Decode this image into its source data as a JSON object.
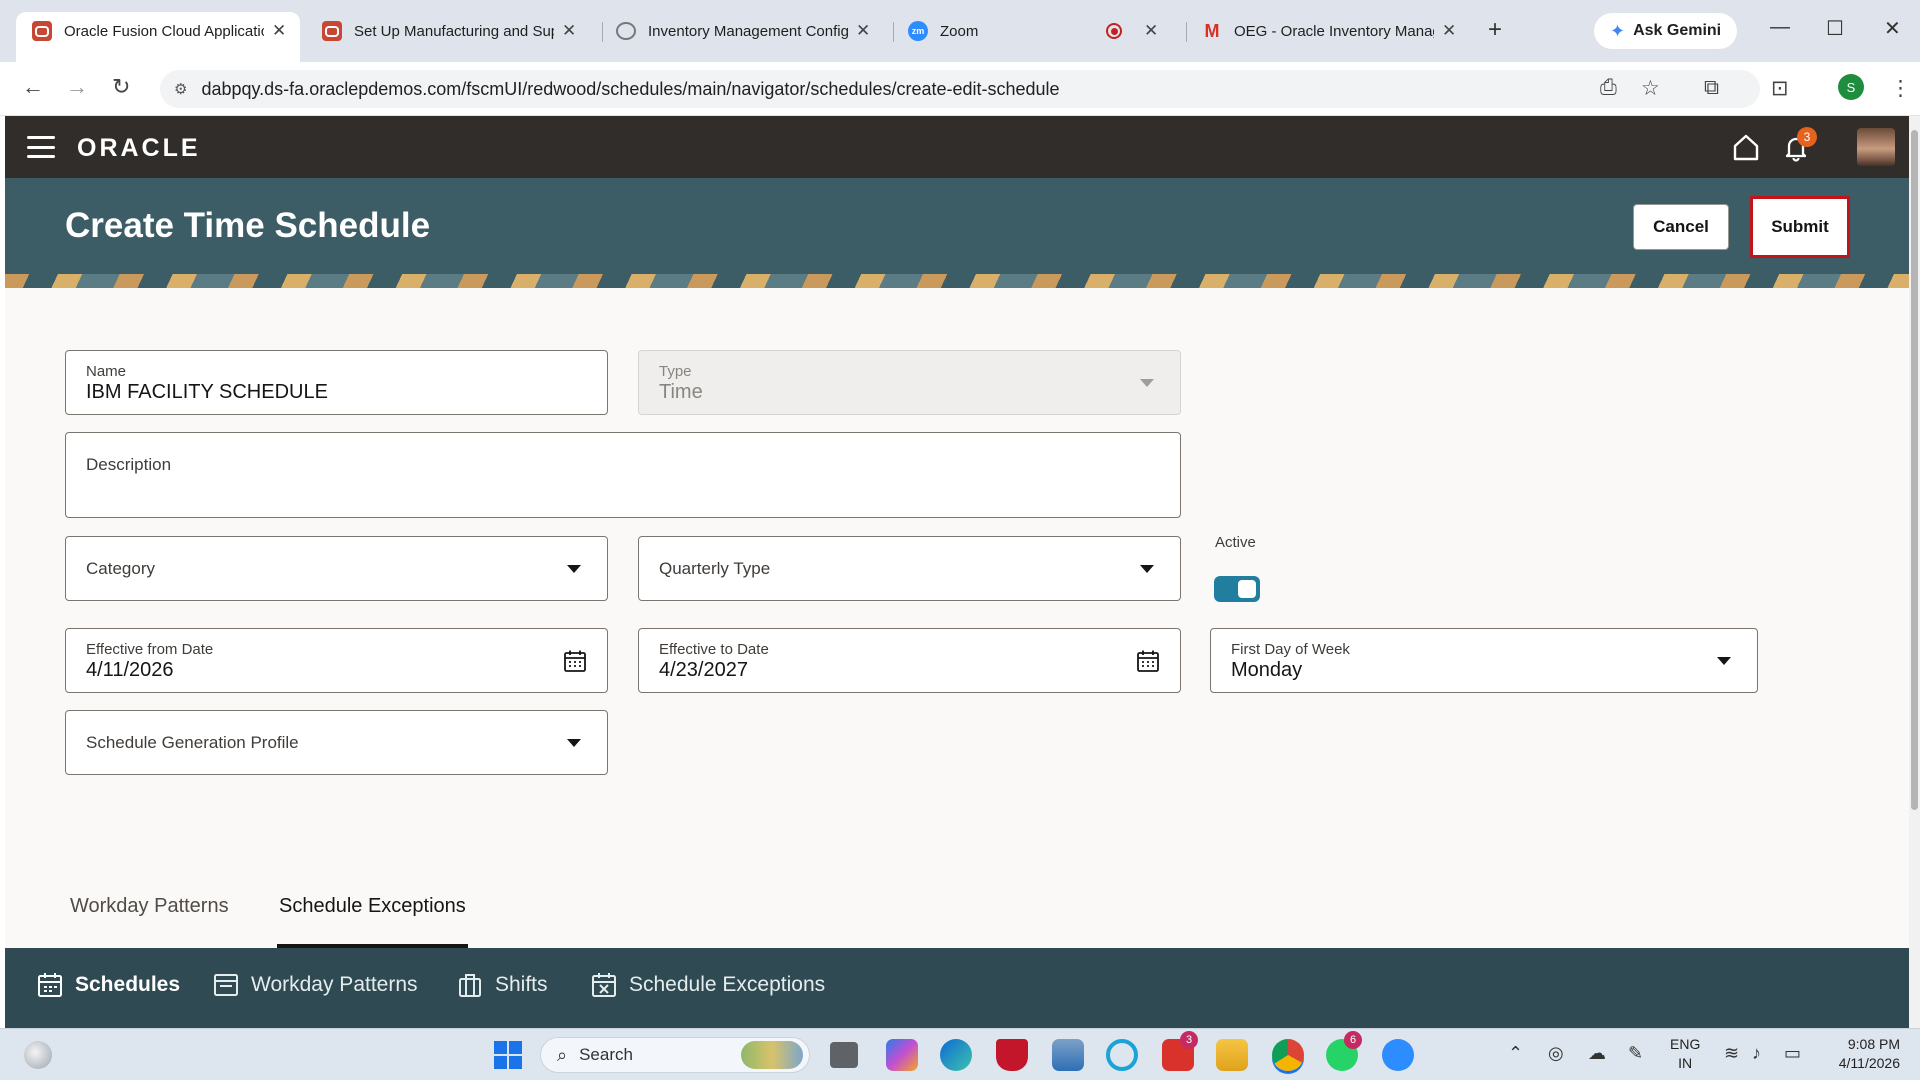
{
  "browser": {
    "tabs": [
      {
        "title": "Oracle Fusion Cloud Applicatic",
        "icon": "oracle-icon",
        "active": true
      },
      {
        "title": "Set Up Manufacturing and Sup",
        "icon": "oracle-icon",
        "active": false
      },
      {
        "title": "Inventory Management Config",
        "icon": "globe-icon",
        "active": false
      },
      {
        "title": "Zoom",
        "icon": "zoom-icon",
        "active": false
      },
      {
        "title": "OEG - Oracle Inventory Manag",
        "icon": "gmail-icon",
        "active": false
      }
    ],
    "gemini_label": "Ask Gemini",
    "url": "dabpqy.ds-fa.oraclepdemos.com/fscmUI/redwood/schedules/main/navigator/schedules/create-edit-schedule",
    "profile_initial": "S"
  },
  "app": {
    "logo": "ORACLE",
    "notification_count": "3"
  },
  "page": {
    "title": "Create Time Schedule",
    "cancel_label": "Cancel",
    "submit_label": "Submit"
  },
  "form": {
    "name": {
      "label": "Name",
      "value": "IBM FACILITY SCHEDULE"
    },
    "type": {
      "label": "Type",
      "value": "Time"
    },
    "description": {
      "label": "Description"
    },
    "category": {
      "label": "Category"
    },
    "quarterly_type": {
      "label": "Quarterly Type"
    },
    "active": {
      "label": "Active",
      "on": true
    },
    "effective_from": {
      "label": "Effective from Date",
      "value": "4/11/2026"
    },
    "effective_to": {
      "label": "Effective to Date",
      "value": "4/23/2027"
    },
    "first_day": {
      "label": "First Day of Week",
      "value": "Monday"
    },
    "generation_profile": {
      "label": "Schedule Generation Profile"
    }
  },
  "page_tabs": [
    {
      "label": "Workday Patterns",
      "selected": false
    },
    {
      "label": "Schedule Exceptions",
      "selected": true
    }
  ],
  "bottom_nav": [
    {
      "label": "Schedules",
      "icon": "calendar-icon",
      "current": true
    },
    {
      "label": "Workday Patterns",
      "icon": "pattern-icon",
      "current": false
    },
    {
      "label": "Shifts",
      "icon": "shifts-icon",
      "current": false
    },
    {
      "label": "Schedule Exceptions",
      "icon": "calendar-exception-icon",
      "current": false
    }
  ],
  "taskbar": {
    "search_label": "Search",
    "lang_line1": "ENG",
    "lang_line2": "IN",
    "time": "9:08 PM",
    "date": "4/11/2026",
    "badge_a": "3",
    "badge_b": "6"
  },
  "colors": {
    "app_header": "#312d2a",
    "banner": "#3c5c66",
    "bottom_nav": "#2f4a52",
    "toggle_on": "#227e9e",
    "submit_highlight": "#c0161b"
  }
}
